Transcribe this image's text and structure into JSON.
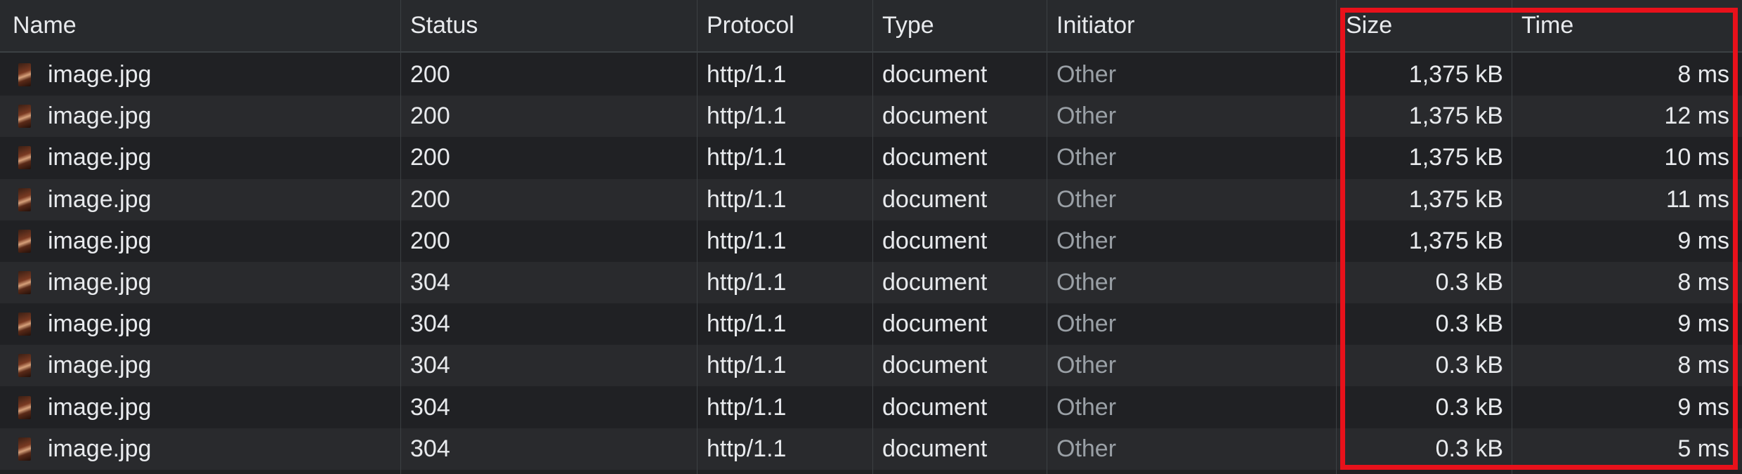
{
  "columns": {
    "name": "Name",
    "status": "Status",
    "protocol": "Protocol",
    "type": "Type",
    "initiator": "Initiator",
    "size": "Size",
    "time": "Time"
  },
  "rows": [
    {
      "name": "image.jpg",
      "status": "200",
      "protocol": "http/1.1",
      "type": "document",
      "initiator": "Other",
      "size": "1,375 kB",
      "time": "8 ms"
    },
    {
      "name": "image.jpg",
      "status": "200",
      "protocol": "http/1.1",
      "type": "document",
      "initiator": "Other",
      "size": "1,375 kB",
      "time": "12 ms"
    },
    {
      "name": "image.jpg",
      "status": "200",
      "protocol": "http/1.1",
      "type": "document",
      "initiator": "Other",
      "size": "1,375 kB",
      "time": "10 ms"
    },
    {
      "name": "image.jpg",
      "status": "200",
      "protocol": "http/1.1",
      "type": "document",
      "initiator": "Other",
      "size": "1,375 kB",
      "time": "11 ms"
    },
    {
      "name": "image.jpg",
      "status": "200",
      "protocol": "http/1.1",
      "type": "document",
      "initiator": "Other",
      "size": "1,375 kB",
      "time": "9 ms"
    },
    {
      "name": "image.jpg",
      "status": "304",
      "protocol": "http/1.1",
      "type": "document",
      "initiator": "Other",
      "size": "0.3 kB",
      "time": "8 ms"
    },
    {
      "name": "image.jpg",
      "status": "304",
      "protocol": "http/1.1",
      "type": "document",
      "initiator": "Other",
      "size": "0.3 kB",
      "time": "9 ms"
    },
    {
      "name": "image.jpg",
      "status": "304",
      "protocol": "http/1.1",
      "type": "document",
      "initiator": "Other",
      "size": "0.3 kB",
      "time": "8 ms"
    },
    {
      "name": "image.jpg",
      "status": "304",
      "protocol": "http/1.1",
      "type": "document",
      "initiator": "Other",
      "size": "0.3 kB",
      "time": "9 ms"
    },
    {
      "name": "image.jpg",
      "status": "304",
      "protocol": "http/1.1",
      "type": "document",
      "initiator": "Other",
      "size": "0.3 kB",
      "time": "5 ms"
    }
  ],
  "icons": {
    "file": "image-file-icon"
  },
  "colors": {
    "highlight": "#e8111b",
    "background": "#202124",
    "initiator_text": "#9aa0a6"
  }
}
